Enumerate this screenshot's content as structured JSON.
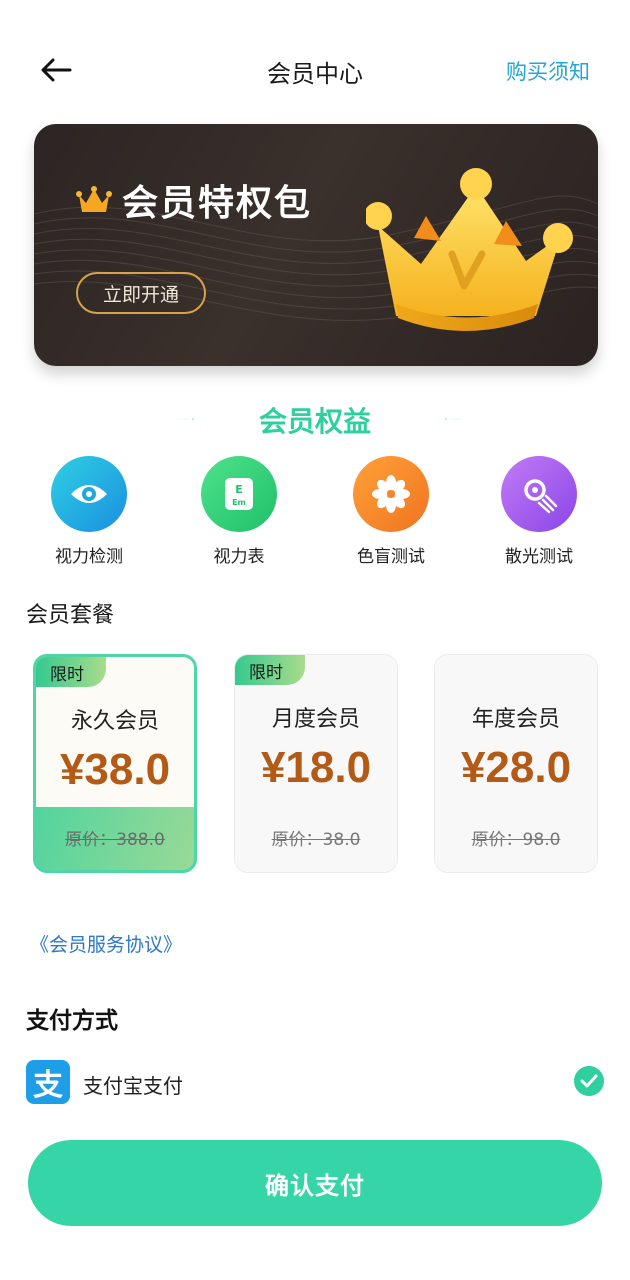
{
  "header": {
    "title": "会员中心",
    "notice_link": "购买须知"
  },
  "banner": {
    "title": "会员特权包",
    "button_label": "立即开通",
    "crown_letter": "V"
  },
  "benefits": {
    "title": "会员权益",
    "items": [
      {
        "label": "视力检测",
        "icon": "eye-icon",
        "color": "#1fb6e8"
      },
      {
        "label": "视力表",
        "icon": "eye-chart-icon",
        "color": "#2ed07a"
      },
      {
        "label": "色盲测试",
        "icon": "flower-icon",
        "color": "#f7892d"
      },
      {
        "label": "散光测试",
        "icon": "astigmatism-icon",
        "color": "#a95cf0"
      }
    ]
  },
  "plans": {
    "heading": "会员套餐",
    "items": [
      {
        "tag": "限时",
        "name": "永久会员",
        "price": "¥38.0",
        "original": "原价：388.0",
        "selected": true
      },
      {
        "tag": "限时",
        "name": "月度会员",
        "price": "¥18.0",
        "original": "原价：38.0",
        "selected": false
      },
      {
        "tag": "",
        "name": "年度会员",
        "price": "¥28.0",
        "original": "原价：98.0",
        "selected": false
      }
    ]
  },
  "agreement": "《会员服务协议》",
  "payment": {
    "heading": "支付方式",
    "method_label": "支付宝支付",
    "method_icon_char": "支",
    "selected": true
  },
  "confirm_label": "确认支付",
  "colors": {
    "accent": "#2fcf9f",
    "price": "#b35a16",
    "link": "#27a4d8",
    "alipay": "#1d9ee6"
  }
}
